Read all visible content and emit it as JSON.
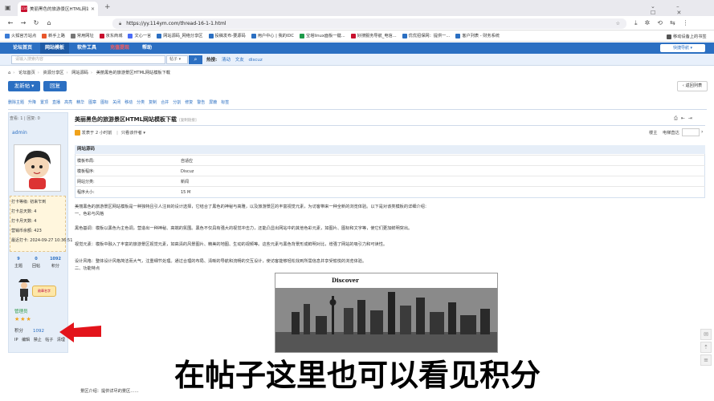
{
  "browser": {
    "tab_favicon": "114",
    "tab_title": "美丽黑色的旅游景区HTML网站...",
    "url": "https://yy.114ym.com/thread-16-1-1.html",
    "bookmarks": [
      "火狐官方站点",
      "新手上路",
      "常用网址",
      "京东商城",
      "文心一言",
      "网站源码_网络分享区",
      "投稿发布-要源码",
      "用户中心 | 我的IDC",
      "宝塔linux面板一键...",
      "好搜服务导航_电信...",
      "优优招保网：提供一...",
      "客户列表 - 财务系统"
    ],
    "mobile_bookmarks": "移动设备上的书签"
  },
  "site_nav": {
    "items": [
      "论坛首页",
      "网站模板",
      "软件工具",
      "充值提现",
      "帮助"
    ],
    "quick_nav": "快捷导航"
  },
  "search": {
    "placeholder": "请输入搜索内容",
    "type": "帖子",
    "hot_label": "热搜:",
    "hot_items": [
      "清动",
      "文友",
      "discuz"
    ]
  },
  "breadcrumb": [
    "论坛首页",
    "资源分享区",
    "网站源码",
    "美丽黑色的旅游景区HTML网站模板下载"
  ],
  "buttons": {
    "new_post": "发新帖",
    "reply": "回复",
    "back_list": "返回列表"
  },
  "mod_actions": [
    "删除主题",
    "升降",
    "置顶",
    "直播",
    "高亮",
    "精华",
    "图章",
    "图标",
    "关闭",
    "移动",
    "分类",
    "复制",
    "合并",
    "分割",
    "修复",
    "警告",
    "屏蔽",
    "标签"
  ],
  "author": {
    "view_reply": "查看: 1 | 回复: 0",
    "name": "admin",
    "info": [
      {
        "k": "打卡等级:",
        "v": "初来乍到"
      },
      {
        "k": "打卡总天数:",
        "v": "4"
      },
      {
        "k": "打卡月天数:",
        "v": "4"
      },
      {
        "k": "营销币余额:",
        "v": "423"
      },
      {
        "k": "最近打卡:",
        "v": "2024-09-27 10:36:51"
      }
    ],
    "stats": [
      {
        "value": "9",
        "label": "主题"
      },
      {
        "value": "0",
        "label": "回帖"
      },
      {
        "value": "1092",
        "label": "积分"
      }
    ],
    "medal": "勋章名字",
    "group": "管理员",
    "stars": "★★★",
    "credit_label": "积分",
    "credit_value": "1092",
    "actions": [
      "IP",
      "编辑",
      "禁止",
      "帖子",
      "清理"
    ]
  },
  "post": {
    "title": "美丽黑色的旅游景区HTML网站模板下载",
    "title_tag": "[复制链接]",
    "meta_author": "发表于",
    "meta_time": "2 小时前",
    "meta_only_author": "只看该作者",
    "right_label": "楼主",
    "right_label2": "电梯直达",
    "attr_head": "网站源码",
    "attrs": [
      {
        "k": "模板布局:",
        "v": "自适应"
      },
      {
        "k": "模板程序:",
        "v": "Discuz"
      },
      {
        "k": "网站分类:",
        "v": "新闻"
      },
      {
        "k": "程序大小:",
        "v": "15 M"
      }
    ],
    "paragraphs": [
      "美丽黑色的旅游景区网站模板是一种独特且引人注目的设计选择，它结合了黑色的神秘与高雅，以及旅游景区的丰富视觉元素，为访客带来一种全新的浏览体验。以下是对该类模板的详细介绍：",
      "一、色彩与风格",
      "黑色基调：模板以黑色为主色调，营造出一种神秘、高端的氛围。黑色不仅具有强大的视觉冲击力，还能凸显出网站中的其他色彩元素，如图片、图标和文字等，使它们更加鲜明突出。",
      "视觉元素：模板中融入了丰富的旅游景区视觉元素，如高清的风景图片、精美的地图、生动的视频等。这些元素与黑色背景形成鲜明对比，增强了网站的吸引力和可读性。",
      "设计风格：整体设计风格简洁而大气，注重细节处理。通过合理的布局、清晰的导航和流畅的交互设计，使访客能够轻松找到所需信息并享受愉悦的浏览体验。",
      "二、功能特点"
    ],
    "screenshot_brand": "Discover",
    "bottom_line": "景区介绍：提供详尽的景区……"
  },
  "caption": "在帖子这里也可以看见积分"
}
